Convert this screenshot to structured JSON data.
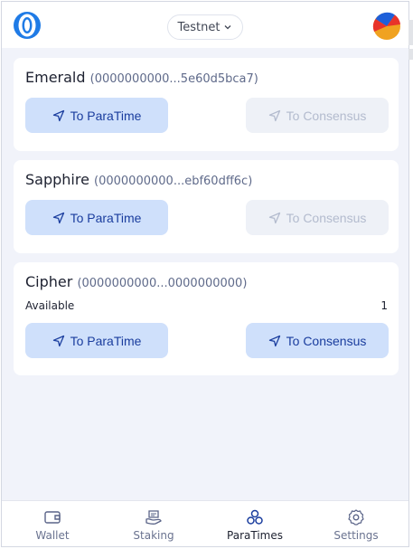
{
  "header": {
    "network_label": "Testnet"
  },
  "paratimes": [
    {
      "name": "Emerald",
      "address": "(0000000000...5e60d5bca7)",
      "to_paratime_label": "To ParaTime",
      "to_consensus_label": "To Consensus",
      "to_consensus_enabled": false
    },
    {
      "name": "Sapphire",
      "address": "(0000000000...ebf60dff6c)",
      "to_paratime_label": "To ParaTime",
      "to_consensus_label": "To Consensus",
      "to_consensus_enabled": false
    },
    {
      "name": "Cipher",
      "address": "(0000000000...0000000000)",
      "available_label": "Available",
      "available_value": "1",
      "to_paratime_label": "To ParaTime",
      "to_consensus_label": "To Consensus",
      "to_consensus_enabled": true
    }
  ],
  "nav": [
    {
      "label": "Wallet",
      "icon": "wallet-icon",
      "active": false
    },
    {
      "label": "Staking",
      "icon": "staking-icon",
      "active": false
    },
    {
      "label": "ParaTimes",
      "icon": "paratimes-icon",
      "active": true
    },
    {
      "label": "Settings",
      "icon": "settings-icon",
      "active": false
    }
  ],
  "colors": {
    "primary_button_bg": "#cfe0fb",
    "primary_button_text": "#1a3d9e",
    "disabled_button_bg": "#eef1f7",
    "disabled_button_text": "#b3bbce",
    "page_bg": "#f1f3fa",
    "logo_blue": "#1f7be6"
  }
}
